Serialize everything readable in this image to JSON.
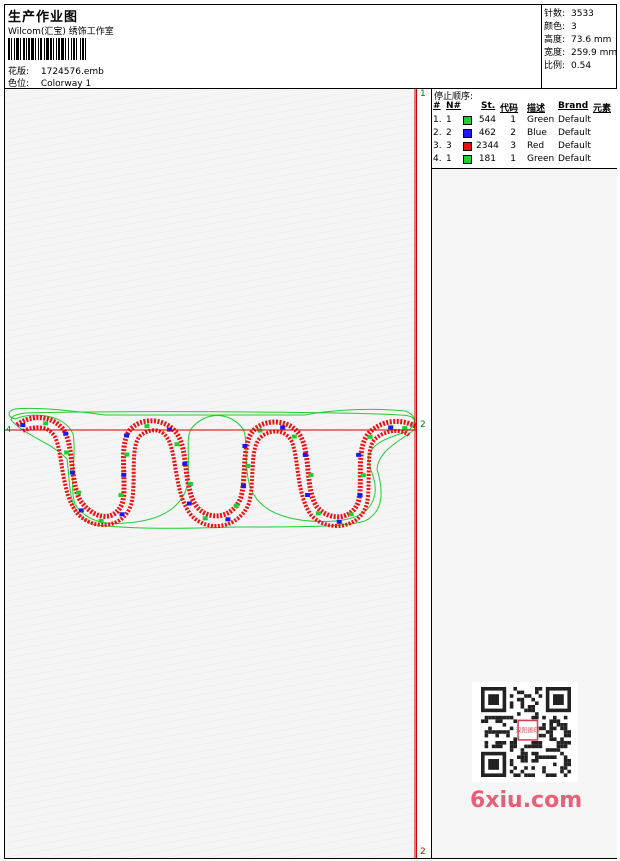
{
  "header": {
    "title": "生产作业图",
    "company": "Wilcom(汇宝) 绣饰工作室",
    "design_label": "花版:",
    "design_value": "1724576.emb",
    "colorway_label": "色位:",
    "colorway_value": "Colorway 1"
  },
  "stats": [
    {
      "label": "针数:",
      "value": "3533"
    },
    {
      "label": "颜色:",
      "value": "3"
    },
    {
      "label": "高度:",
      "value": "73.6 mm"
    },
    {
      "label": "宽度:",
      "value": "259.9 mm"
    },
    {
      "label": "比例:",
      "value": "0.54"
    }
  ],
  "stop_sequence": {
    "title": "停止顺序:",
    "columns": [
      "#",
      "N#",
      "St.",
      "代码",
      "描述",
      "Brand",
      "元素"
    ],
    "rows": [
      {
        "num": "1.",
        "n": "1",
        "color": "#22cc33",
        "stitches": "544",
        "code": "1",
        "desc": "Green",
        "brand": "Default"
      },
      {
        "num": "2.",
        "n": "2",
        "color": "#1a1aee",
        "stitches": "462",
        "code": "2",
        "desc": "Blue",
        "brand": "Default"
      },
      {
        "num": "3.",
        "n": "3",
        "color": "#ee1111",
        "stitches": "2344",
        "code": "3",
        "desc": "Red",
        "brand": "Default"
      },
      {
        "num": "4.",
        "n": "1",
        "color": "#22cc33",
        "stitches": "181",
        "code": "1",
        "desc": "Green",
        "brand": "Default"
      }
    ]
  },
  "markers": {
    "rail_top": "1",
    "rail_mid": "2",
    "rail_bottom": "2",
    "left_mark": "4"
  },
  "watermark": {
    "site": "6xiu.com",
    "stamp": "汉阳图印"
  },
  "colors": {
    "outline_green": "#22cc33",
    "satin_red": "#ee1111",
    "fill_blue": "#1a1aee",
    "guide_red": "#cc0000"
  }
}
